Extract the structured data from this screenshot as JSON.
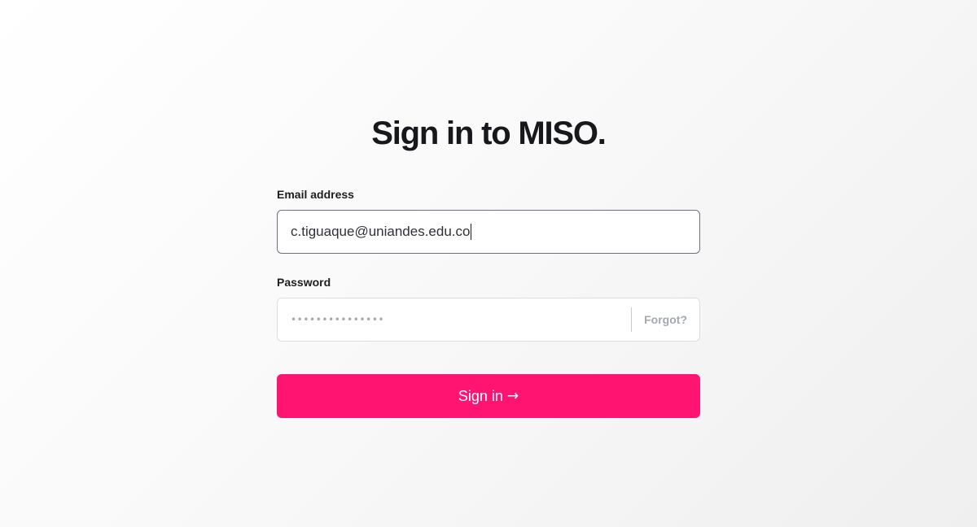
{
  "heading": "Sign in to MISO.",
  "email": {
    "label": "Email address",
    "value": "c.tiguaque@uniandes.edu.co"
  },
  "password": {
    "label": "Password",
    "masked_value": "•••••••••••••••",
    "forgot_label": "Forgot?"
  },
  "submit": {
    "label": "Sign in",
    "icon": "arrow-right-icon",
    "glyph": "→"
  },
  "colors": {
    "accent": "#ff1472",
    "text": "#17181c",
    "muted": "#a4a8b0"
  }
}
